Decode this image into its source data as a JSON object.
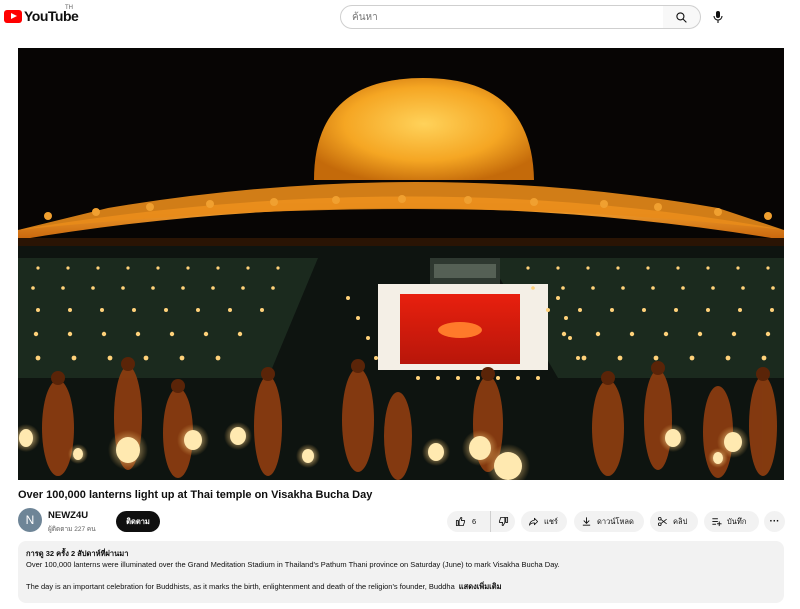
{
  "header": {
    "logo_text": "YouTube",
    "region": "TH",
    "search_placeholder": "ค้นหา",
    "icons": [
      "youtube-logo",
      "search-icon",
      "mic-icon"
    ]
  },
  "video": {
    "title": "Over 100,000 lanterns light up at Thai temple on Visakha Bucha Day"
  },
  "channel": {
    "avatar_letter": "N",
    "name": "NEWZ4U",
    "subscribers": "ผู้ติดตาม 227 คน",
    "subscribe_label": "ติดตาม"
  },
  "actions": {
    "like_count": "6",
    "share_label": "แชร์",
    "download_label": "ดาวน์โหลด",
    "clip_label": "คลิป",
    "save_label": "บันทึก",
    "more_label": "···"
  },
  "description": {
    "meta": "การดู 32 ครั้ง  2 สัปดาห์ที่ผ่านมา",
    "line1": "Over 100,000 lanterns were illuminated over the Grand Meditation Stadium in Thailand's Pathum Thani province on Saturday (June) to mark Visakha Bucha Day.",
    "line2": "The day is an important celebration for Buddhists, as it marks the birth, enlightenment and death of the religion's founder, Buddha",
    "more_label": "แสดงเพิ่มเติม"
  },
  "colors": {
    "brand_red": "#ff0000",
    "dome_gold": "#f5a623",
    "lantern_glow": "#ffd27a"
  }
}
